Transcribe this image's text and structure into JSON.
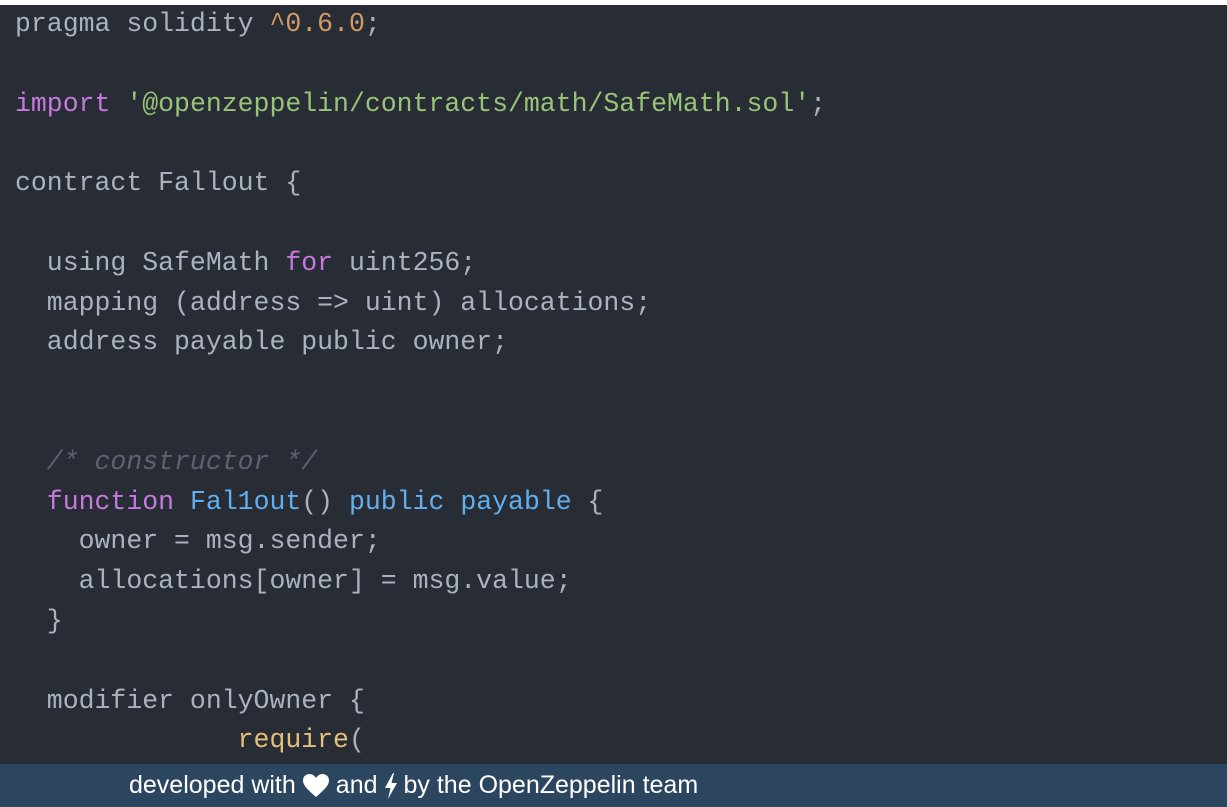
{
  "code": {
    "language": "solidity",
    "lines": [
      [
        {
          "t": "pragma solidity ",
          "c": "plain"
        },
        {
          "t": "^0.6.0",
          "c": "number"
        },
        {
          "t": ";",
          "c": "plain"
        }
      ],
      [],
      [
        {
          "t": "import",
          "c": "keyword"
        },
        {
          "t": " ",
          "c": "plain"
        },
        {
          "t": "'@openzeppelin/contracts/math/SafeMath.sol'",
          "c": "string"
        },
        {
          "t": ";",
          "c": "plain"
        }
      ],
      [],
      [
        {
          "t": "contract Fallout {",
          "c": "plain"
        }
      ],
      [],
      [
        {
          "t": "  using SafeMath ",
          "c": "plain"
        },
        {
          "t": "for",
          "c": "keyword"
        },
        {
          "t": " uint256;",
          "c": "plain"
        }
      ],
      [
        {
          "t": "  mapping (address => uint) allocations;",
          "c": "plain"
        }
      ],
      [
        {
          "t": "  address payable public owner;",
          "c": "plain"
        }
      ],
      [],
      [],
      [
        {
          "t": "  /* constructor */",
          "c": "comment"
        }
      ],
      [
        {
          "t": "  ",
          "c": "plain"
        },
        {
          "t": "function",
          "c": "keyword"
        },
        {
          "t": " ",
          "c": "plain"
        },
        {
          "t": "Fal1out",
          "c": "fn"
        },
        {
          "t": "() ",
          "c": "plain"
        },
        {
          "t": "public",
          "c": "fn"
        },
        {
          "t": " ",
          "c": "plain"
        },
        {
          "t": "payable",
          "c": "fn"
        },
        {
          "t": " {",
          "c": "plain"
        }
      ],
      [
        {
          "t": "    owner = msg.sender;",
          "c": "plain"
        }
      ],
      [
        {
          "t": "    allocations[owner] = msg.value;",
          "c": "plain"
        }
      ],
      [
        {
          "t": "  }",
          "c": "plain"
        }
      ],
      [],
      [
        {
          "t": "  modifier onlyOwner {",
          "c": "plain"
        }
      ],
      [
        {
          "t": "              ",
          "c": "plain"
        },
        {
          "t": "require",
          "c": "builtin"
        },
        {
          "t": "(",
          "c": "plain"
        }
      ]
    ]
  },
  "footer": {
    "prefix": "developed with",
    "heart_icon": "heart-icon",
    "middle": "and",
    "bolt_icon": "lightning-bolt-icon",
    "suffix": "by the OpenZeppelin team"
  },
  "colors": {
    "editor_background": "#282c34",
    "footer_background": "#2c4660",
    "plain": "#abb2bf",
    "keyword": "#c678dd",
    "number": "#d19a66",
    "string": "#98c379",
    "comment": "#5c6370",
    "function": "#61afef",
    "builtin": "#e5c07b"
  }
}
